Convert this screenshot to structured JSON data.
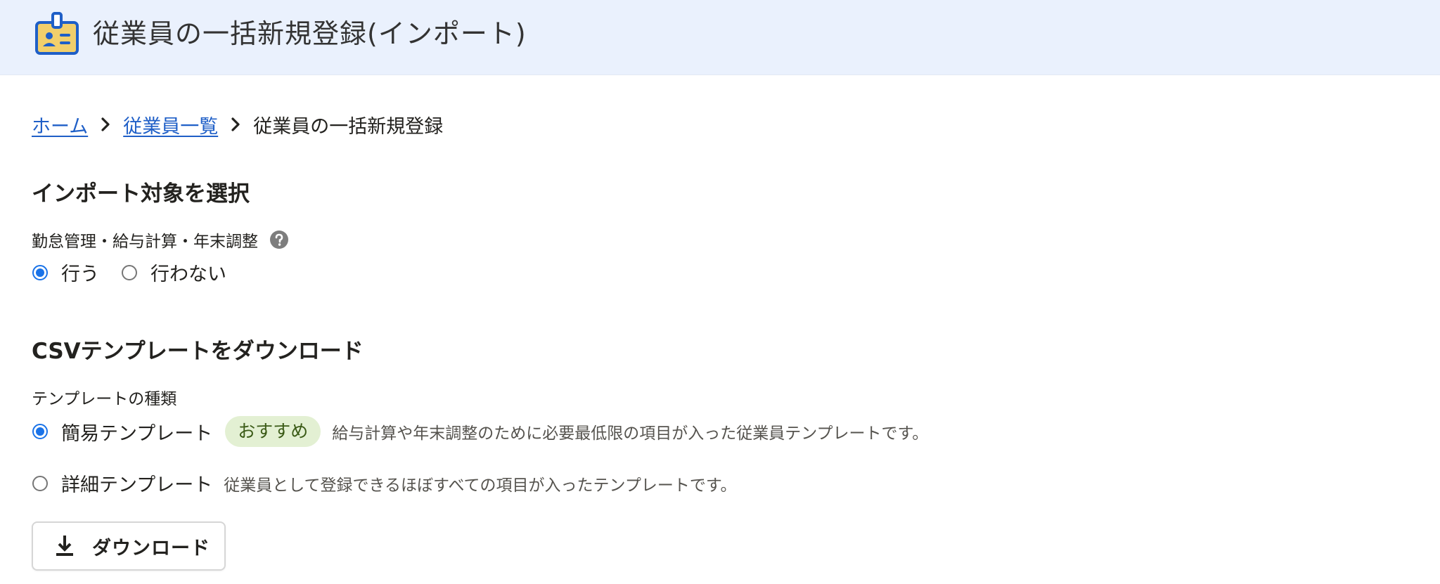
{
  "header": {
    "title": "従業員の一括新規登録(インポート)",
    "icon": "employee-id-card-icon",
    "background": "#eaf1fd",
    "icon_color": "#1f5fc7",
    "icon_fill": "#f2cf6b"
  },
  "breadcrumb": {
    "items": [
      "ホーム",
      "従業員一覧"
    ],
    "current": "従業員の一括新規登録",
    "link_color": "#1f5fc7"
  },
  "import_section": {
    "heading": "インポート対象を選択",
    "field_label": "勤怠管理・給与計算・年末調整",
    "help_icon": "question-circle-icon",
    "options": [
      {
        "label": "行う",
        "selected": true
      },
      {
        "label": "行わない",
        "selected": false
      }
    ]
  },
  "csv_section": {
    "heading": "CSVテンプレートをダウンロード",
    "field_label": "テンプレートの種類",
    "options": [
      {
        "label": "簡易テンプレート",
        "selected": true,
        "badge": "おすすめ",
        "description": "給与計算や年末調整のために必要最低限の項目が入った従業員テンプレートです。"
      },
      {
        "label": "詳細テンプレート",
        "selected": false,
        "description": "従業員として登録できるほぼすべての項目が入ったテンプレートです。"
      }
    ],
    "badge_bg": "#e3f0d3",
    "download_label": "ダウンロード",
    "download_icon": "download-icon"
  },
  "accent_color": "#1a73e8"
}
